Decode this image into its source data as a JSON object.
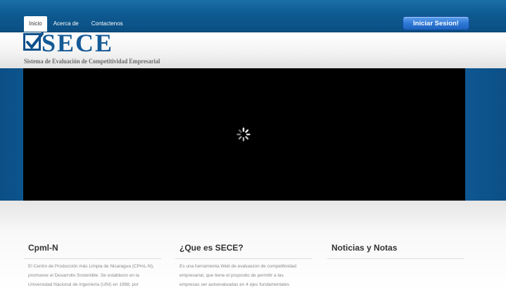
{
  "nav": {
    "items": [
      {
        "label": "Inicio",
        "active": true
      },
      {
        "label": "Acerca de",
        "active": false
      },
      {
        "label": "Contactenos",
        "active": false
      }
    ],
    "login_label": "Iniciar Sesion!"
  },
  "logo": {
    "word": "SECE",
    "subtitle": "Sistema de Evaluación de Competitividad Empresarial"
  },
  "video": {
    "state": "loading",
    "icon": "spinner-icon"
  },
  "columns": [
    {
      "title": "Cpml-N",
      "lines": [
        "El Centro de Producción más Limpia de Nicaragua (CPmL-N),",
        "promueve el Desarrollo Sostenible. Se establecio en la",
        "Universidad Nacional de Ingeniería (UNI) en 1998, por"
      ]
    },
    {
      "title": "¿Que es SECE?",
      "lines": [
        "Es una herramienta Web de evaluacion de competitividad",
        "empresarial, que tiene el proposito de permitir a las",
        "empresas ser autoevaluadas en 4 ejes fundamentales"
      ]
    },
    {
      "title": "Noticias y Notas",
      "lines": []
    }
  ],
  "colors": {
    "topbar": "#0e5a92",
    "brand_blue": "#145a96",
    "button_blue": "#2f79d6"
  }
}
